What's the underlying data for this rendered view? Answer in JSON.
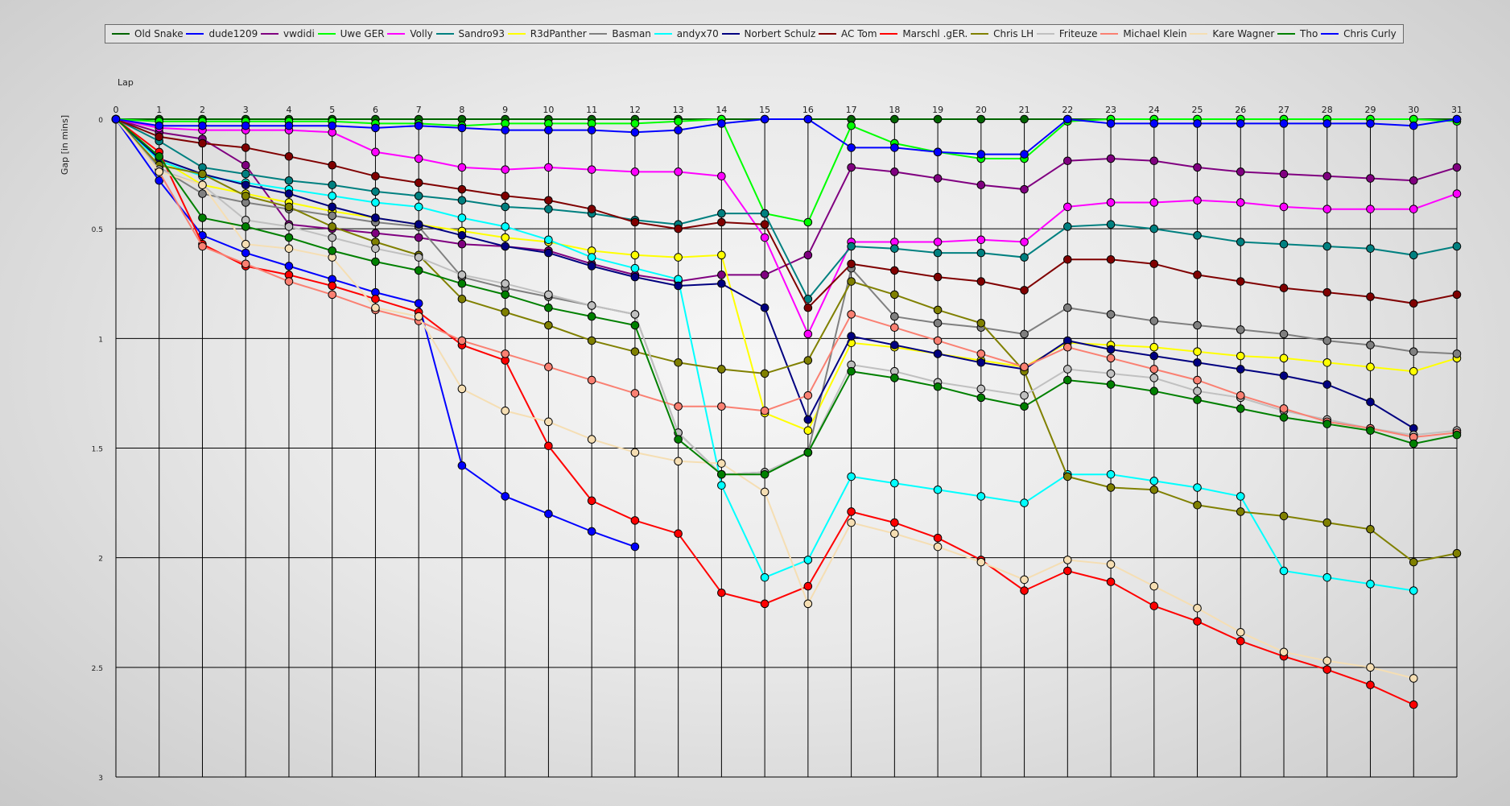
{
  "chart_data": {
    "type": "line",
    "title": "",
    "xlabel": "Lap",
    "ylabel": "Gap [in mins]",
    "x": [
      0,
      1,
      2,
      3,
      4,
      5,
      6,
      7,
      8,
      9,
      10,
      11,
      12,
      13,
      14,
      15,
      16,
      17,
      18,
      19,
      20,
      21,
      22,
      23,
      24,
      25,
      26,
      27,
      28,
      29,
      30,
      31
    ],
    "xlim": [
      0,
      31
    ],
    "ylim": [
      0,
      3
    ],
    "y_inverted": true,
    "y_ticks": [
      "0",
      "0.5",
      "1",
      "1.5",
      "2",
      "2.5",
      "3"
    ],
    "grid": true,
    "legend_position": "top",
    "series": [
      {
        "name": "Old Snake",
        "color": "#006400",
        "values": [
          0,
          0,
          0,
          0,
          0,
          0,
          0,
          0,
          0,
          0,
          0,
          0,
          0,
          0,
          0,
          0,
          0,
          0,
          0,
          0,
          0,
          0,
          0,
          0,
          0,
          0,
          0,
          0,
          0,
          0,
          0,
          0
        ]
      },
      {
        "name": "dude1209",
        "color": "#0000ff",
        "values": [
          0,
          0.28,
          0.53,
          0.61,
          0.67,
          0.73,
          0.79,
          0.84,
          1.58,
          1.72,
          1.8,
          1.88,
          1.95,
          null,
          null,
          null,
          null,
          null,
          null,
          null,
          null,
          null,
          null,
          null,
          null,
          null,
          null,
          null,
          null,
          null,
          null,
          null
        ]
      },
      {
        "name": "vwdidi",
        "color": "#800080",
        "values": [
          0,
          0.06,
          0.09,
          0.21,
          0.48,
          0.5,
          0.52,
          0.54,
          0.57,
          0.58,
          0.6,
          0.66,
          0.71,
          0.74,
          0.71,
          0.71,
          0.62,
          0.22,
          0.24,
          0.27,
          0.3,
          0.32,
          0.19,
          0.18,
          0.19,
          0.22,
          0.24,
          0.25,
          0.26,
          0.27,
          0.28,
          0.22
        ]
      },
      {
        "name": "Uwe GER",
        "color": "#00ff00",
        "values": [
          0,
          0.01,
          0.01,
          0.01,
          0.01,
          0.01,
          0.02,
          0.02,
          0.03,
          0.02,
          0.02,
          0.02,
          0.02,
          0.01,
          0.0,
          0.43,
          0.47,
          0.03,
          0.11,
          0.15,
          0.18,
          0.18,
          0.01,
          0.0,
          0.0,
          0.0,
          0.0,
          0.0,
          0.0,
          0.0,
          0.0,
          0.01
        ]
      },
      {
        "name": "Volly",
        "color": "#ff00ff",
        "values": [
          0,
          0.04,
          0.05,
          0.05,
          0.05,
          0.06,
          0.15,
          0.18,
          0.22,
          0.23,
          0.22,
          0.23,
          0.24,
          0.24,
          0.26,
          0.54,
          0.98,
          0.56,
          0.56,
          0.56,
          0.55,
          0.56,
          0.4,
          0.38,
          0.38,
          0.37,
          0.38,
          0.4,
          0.41,
          0.41,
          0.41,
          0.34
        ]
      },
      {
        "name": "Sandro93",
        "color": "#008080",
        "values": [
          0,
          0.1,
          0.22,
          0.25,
          0.28,
          0.3,
          0.33,
          0.35,
          0.37,
          0.4,
          0.41,
          0.43,
          0.46,
          0.48,
          0.43,
          0.43,
          0.82,
          0.58,
          0.59,
          0.61,
          0.61,
          0.63,
          0.49,
          0.48,
          0.5,
          0.53,
          0.56,
          0.57,
          0.58,
          0.59,
          0.62,
          0.58
        ]
      },
      {
        "name": "R3dPanther",
        "color": "#ffff00",
        "values": [
          0,
          0.18,
          0.3,
          0.34,
          0.38,
          0.42,
          0.45,
          0.48,
          0.51,
          0.54,
          0.56,
          0.6,
          0.62,
          0.63,
          0.62,
          1.34,
          1.42,
          1.02,
          1.04,
          1.07,
          1.1,
          1.13,
          1.02,
          1.03,
          1.04,
          1.06,
          1.08,
          1.09,
          1.11,
          1.13,
          1.15,
          1.09
        ]
      },
      {
        "name": "Basman",
        "color": "#808080",
        "values": [
          0,
          0.22,
          0.34,
          0.38,
          0.41,
          0.44,
          0.47,
          0.49,
          0.72,
          0.77,
          0.81,
          0.85,
          0.89,
          1.43,
          1.62,
          1.61,
          1.52,
          0.68,
          0.9,
          0.93,
          0.95,
          0.98,
          0.86,
          0.89,
          0.92,
          0.94,
          0.96,
          0.98,
          1.01,
          1.03,
          1.06,
          1.07
        ]
      },
      {
        "name": "andyx70",
        "color": "#00ffff",
        "values": [
          0,
          0.19,
          0.26,
          0.29,
          0.32,
          0.35,
          0.38,
          0.4,
          0.45,
          0.49,
          0.55,
          0.63,
          0.68,
          0.73,
          1.67,
          2.09,
          2.01,
          1.63,
          1.66,
          1.69,
          1.72,
          1.75,
          1.62,
          1.62,
          1.65,
          1.68,
          1.72,
          2.06,
          2.09,
          2.12,
          2.15,
          null
        ]
      },
      {
        "name": "Norbert Schulz",
        "color": "#000080",
        "values": [
          0,
          0.18,
          0.25,
          0.3,
          0.34,
          0.4,
          0.45,
          0.48,
          0.53,
          0.58,
          0.61,
          0.67,
          0.72,
          0.76,
          0.75,
          0.86,
          1.37,
          0.99,
          1.03,
          1.07,
          1.11,
          1.14,
          1.01,
          1.05,
          1.08,
          1.11,
          1.14,
          1.17,
          1.21,
          1.29,
          1.41,
          null
        ]
      },
      {
        "name": "AC Tom",
        "color": "#800000",
        "values": [
          0,
          0.08,
          0.11,
          0.13,
          0.17,
          0.21,
          0.26,
          0.29,
          0.32,
          0.35,
          0.37,
          0.41,
          0.47,
          0.5,
          0.47,
          0.48,
          0.86,
          0.66,
          0.69,
          0.72,
          0.74,
          0.78,
          0.64,
          0.64,
          0.66,
          0.71,
          0.74,
          0.77,
          0.79,
          0.81,
          0.84,
          0.8
        ]
      },
      {
        "name": "Marschl .gER.",
        "color": "#ff0000",
        "values": [
          0,
          0.15,
          0.57,
          0.67,
          0.71,
          0.76,
          0.82,
          0.88,
          1.03,
          1.1,
          1.49,
          1.74,
          1.83,
          1.89,
          2.16,
          2.21,
          2.13,
          1.79,
          1.84,
          1.91,
          2.01,
          2.15,
          2.06,
          2.11,
          2.22,
          2.29,
          2.38,
          2.45,
          2.51,
          2.58,
          2.67,
          null
        ]
      },
      {
        "name": "Chris LH",
        "color": "#808000",
        "values": [
          0,
          0.21,
          0.25,
          0.35,
          0.4,
          0.49,
          0.56,
          0.62,
          0.82,
          0.88,
          0.94,
          1.01,
          1.06,
          1.11,
          1.14,
          1.16,
          1.1,
          0.74,
          0.8,
          0.87,
          0.93,
          1.15,
          1.63,
          1.68,
          1.69,
          1.76,
          1.79,
          1.81,
          1.84,
          1.87,
          2.02,
          1.98
        ]
      },
      {
        "name": "Friteuze",
        "color": "#c0c0c0",
        "values": [
          0,
          0.23,
          0.3,
          0.46,
          0.49,
          0.54,
          0.59,
          0.63,
          0.71,
          0.75,
          0.8,
          0.85,
          0.89,
          1.43,
          1.62,
          1.61,
          1.52,
          1.12,
          1.15,
          1.2,
          1.23,
          1.26,
          1.14,
          1.16,
          1.18,
          1.24,
          1.27,
          1.33,
          1.37,
          1.41,
          1.44,
          1.42
        ]
      },
      {
        "name": "Michael Klein",
        "color": "#fa8072",
        "values": [
          0,
          0.24,
          0.58,
          0.66,
          0.74,
          0.8,
          0.87,
          0.92,
          1.01,
          1.07,
          1.13,
          1.19,
          1.25,
          1.31,
          1.31,
          1.33,
          1.26,
          0.89,
          0.95,
          1.01,
          1.07,
          1.13,
          1.04,
          1.09,
          1.14,
          1.19,
          1.26,
          1.32,
          1.38,
          1.41,
          1.45,
          1.43
        ]
      },
      {
        "name": "Kare Wagner",
        "color": "#f5deb3",
        "values": [
          0,
          0.24,
          0.3,
          0.57,
          0.59,
          0.63,
          0.86,
          0.9,
          1.23,
          1.33,
          1.38,
          1.46,
          1.52,
          1.56,
          1.57,
          1.7,
          2.21,
          1.84,
          1.89,
          1.95,
          2.02,
          2.1,
          2.01,
          2.03,
          2.13,
          2.23,
          2.34,
          2.43,
          2.47,
          2.5,
          2.55,
          null
        ]
      },
      {
        "name": "Tho",
        "color": "#008000",
        "values": [
          0,
          0.17,
          0.45,
          0.49,
          0.54,
          0.6,
          0.65,
          0.69,
          0.75,
          0.8,
          0.86,
          0.9,
          0.94,
          1.46,
          1.62,
          1.62,
          1.52,
          1.15,
          1.18,
          1.22,
          1.27,
          1.31,
          1.19,
          1.21,
          1.24,
          1.28,
          1.32,
          1.36,
          1.39,
          1.42,
          1.48,
          1.44
        ]
      },
      {
        "name": "Chris Curly",
        "color": "#0000ff",
        "values": [
          0,
          0.03,
          0.03,
          0.03,
          0.03,
          0.03,
          0.04,
          0.03,
          0.04,
          0.05,
          0.05,
          0.05,
          0.06,
          0.05,
          0.02,
          0.0,
          0.0,
          0.13,
          0.13,
          0.15,
          0.16,
          0.16,
          0.0,
          0.02,
          0.02,
          0.02,
          0.02,
          0.02,
          0.02,
          0.02,
          0.03,
          0.0
        ]
      }
    ]
  }
}
